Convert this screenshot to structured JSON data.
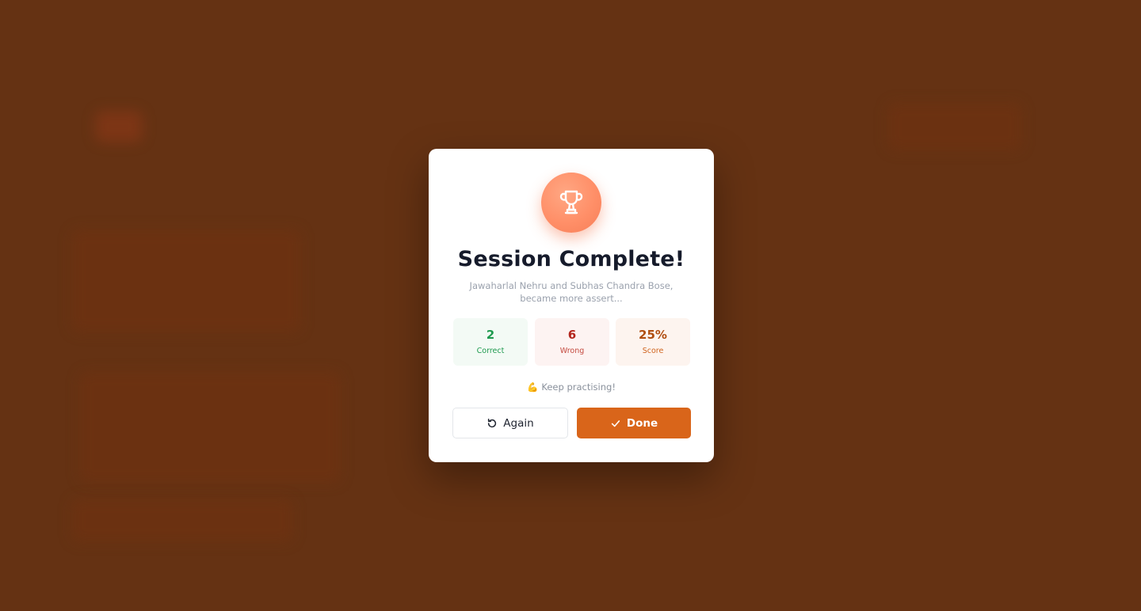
{
  "modal": {
    "title": "Session Complete!",
    "subtitle": "Jawaharlal Nehru and Subhas Chandra Bose, became more assert...",
    "icon": "trophy-icon",
    "stats": {
      "correct": {
        "value": "2",
        "label": "Correct"
      },
      "wrong": {
        "value": "6",
        "label": "Wrong"
      },
      "score": {
        "value": "25%",
        "label": "Score"
      }
    },
    "message": {
      "emoji": "💪",
      "text": "Keep practising!"
    },
    "buttons": {
      "again": {
        "label": "Again",
        "icon": "refresh-icon"
      },
      "done": {
        "label": "Done",
        "icon": "check-icon"
      }
    }
  },
  "colors": {
    "backdrop": "#653213",
    "accent": "#d9651a",
    "trophy": "#ff8f68",
    "correct": "#1f9a4f",
    "wrong": "#b3261e",
    "score": "#b04e11"
  }
}
